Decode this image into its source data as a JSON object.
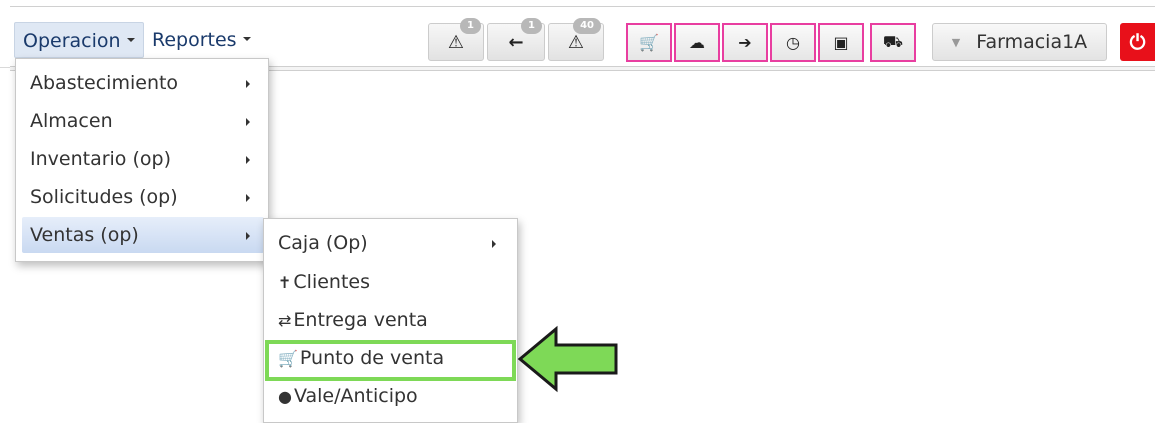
{
  "nav": {
    "operacion": "Operacion",
    "reportes": "Reportes"
  },
  "toolbar": {
    "buttons": [
      {
        "icon": "warning-icon",
        "glyph": "⚠",
        "badge": "1"
      },
      {
        "icon": "arrow-left-icon",
        "glyph": "←",
        "badge": "1"
      },
      {
        "icon": "warning-icon",
        "glyph": "⚠",
        "badge": "40"
      }
    ],
    "pink_buttons": [
      {
        "icon": "shopping-cart-icon",
        "glyph": "🛒"
      },
      {
        "icon": "cloud-upload-icon",
        "glyph": "☁"
      },
      {
        "icon": "sign-in-icon",
        "glyph": "➔"
      },
      {
        "icon": "clock-icon",
        "glyph": "◷"
      },
      {
        "icon": "safe-icon",
        "glyph": "▣"
      },
      {
        "icon": "car-icon",
        "glyph": "⛟"
      }
    ],
    "store_label": "Farmacia1A",
    "power_glyph": "⏻"
  },
  "operacion_menu": [
    {
      "label": "Abastecimiento"
    },
    {
      "label": "Almacen"
    },
    {
      "label": "Inventario (op)"
    },
    {
      "label": "Solicitudes (op)"
    },
    {
      "label": "Ventas (op)"
    }
  ],
  "ventas_submenu": [
    {
      "label": "Caja (Op)",
      "icon": ""
    },
    {
      "label": "Clientes",
      "icon": "✝"
    },
    {
      "label": "Entrega venta",
      "icon": "⇄"
    },
    {
      "label": "Punto de venta",
      "icon": "🛒"
    },
    {
      "label": "Vale/Anticipo",
      "icon": "●"
    }
  ],
  "colors": {
    "accent_pink": "#e83ea0",
    "highlight_green": "#7ed957",
    "power_red": "#e8101a"
  }
}
